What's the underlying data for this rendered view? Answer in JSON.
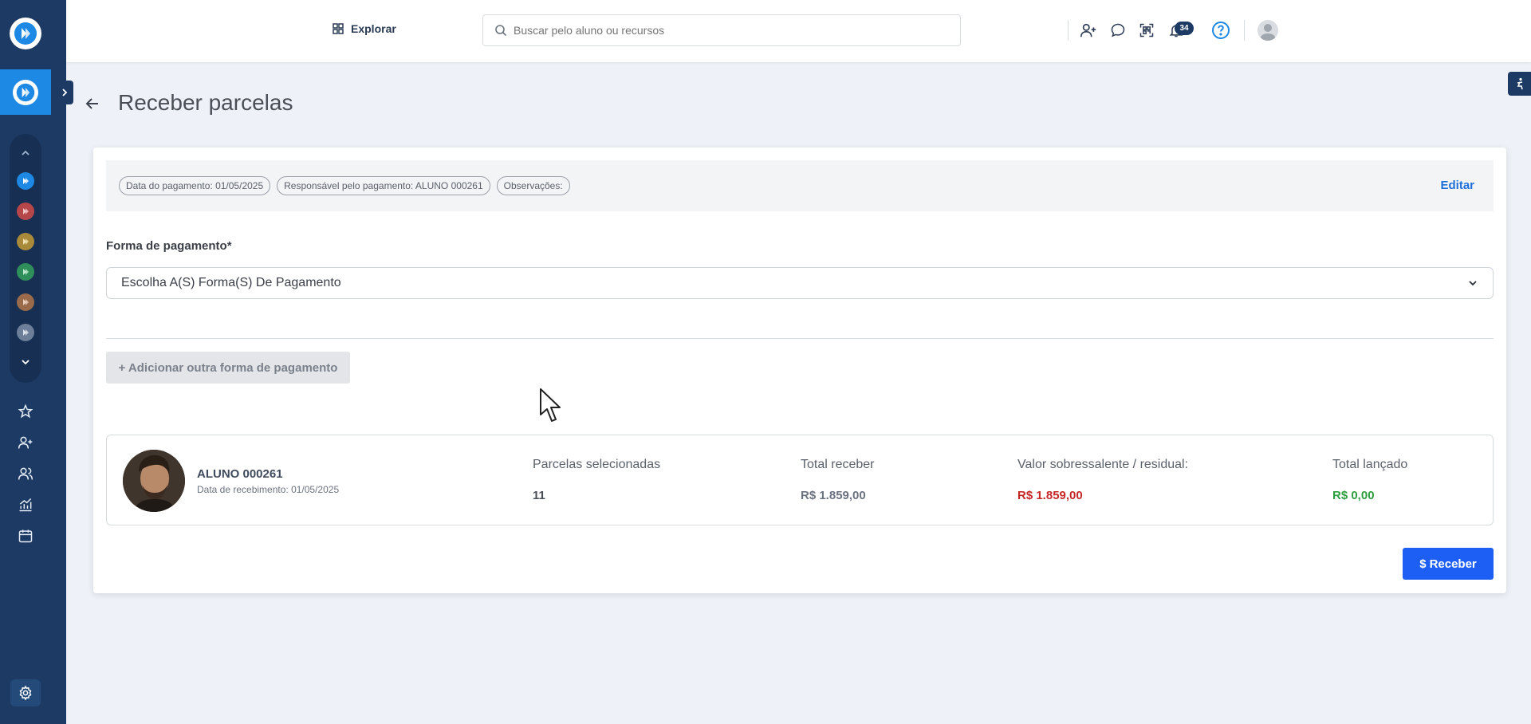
{
  "topbar": {
    "explore_label": "Explorar",
    "search_placeholder": "Buscar pelo aluno ou recursos",
    "notifications_count": "34"
  },
  "page": {
    "title": "Receber parcelas"
  },
  "info": {
    "payment_date": "Data do pagamento: 01/05/2025",
    "responsible": "Responsável pelo pagamento: ALUNO 000261",
    "notes": "Observações:",
    "edit_label": "Editar"
  },
  "form": {
    "payment_label": "Forma de pagamento*",
    "payment_select": "Escolha A(S) Forma(S) De Pagamento",
    "add_payment_label": "+ Adicionar outra forma de pagamento"
  },
  "student": {
    "name": "ALUNO 000261",
    "receive_date": "Data de recebimento: 01/05/2025",
    "col1_label": "Parcelas selecionadas",
    "col1_value": "11",
    "col2_label": "Total receber",
    "col2_value": "R$ 1.859,00",
    "col3_label": "Valor sobressalente / residual:",
    "col3_value": "R$ 1.859,00",
    "col4_label": "Total lançado",
    "col4_value": "R$ 0,00"
  },
  "actions": {
    "receive_label": "Receber"
  },
  "colors": {
    "sidebar": "#1c3a63",
    "accent": "#1e88e5",
    "primary_button": "#1d5ff5",
    "residual_red": "#c62828",
    "launched_green": "#2e9e3e"
  }
}
